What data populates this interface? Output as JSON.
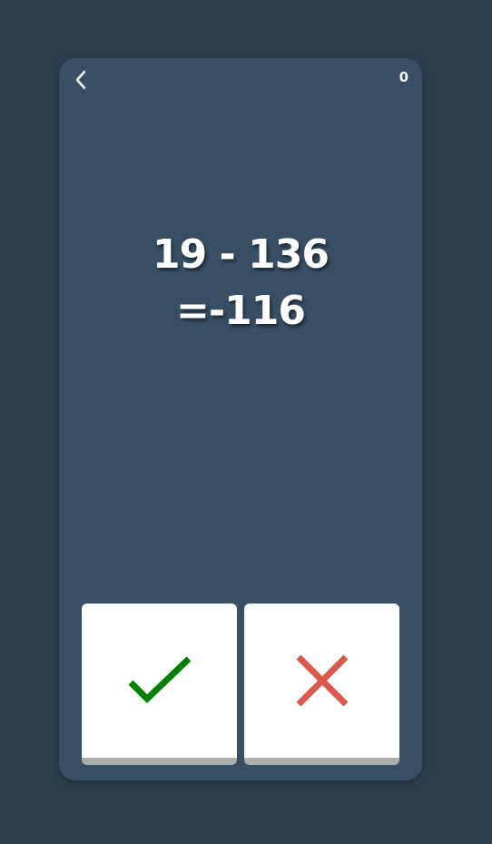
{
  "game": {
    "score": "0",
    "problem": "19 - 136",
    "proposed_answer": "=-116"
  },
  "buttons": {
    "correct": {
      "icon": "check-icon",
      "color": "#008000"
    },
    "wrong": {
      "icon": "cross-icon",
      "color": "#d9594c"
    }
  },
  "colors": {
    "background": "#2d3e4f",
    "card": "#374e64",
    "text": "#ffffff",
    "button_face": "#ffffff",
    "button_edge": "#aeaeae"
  }
}
